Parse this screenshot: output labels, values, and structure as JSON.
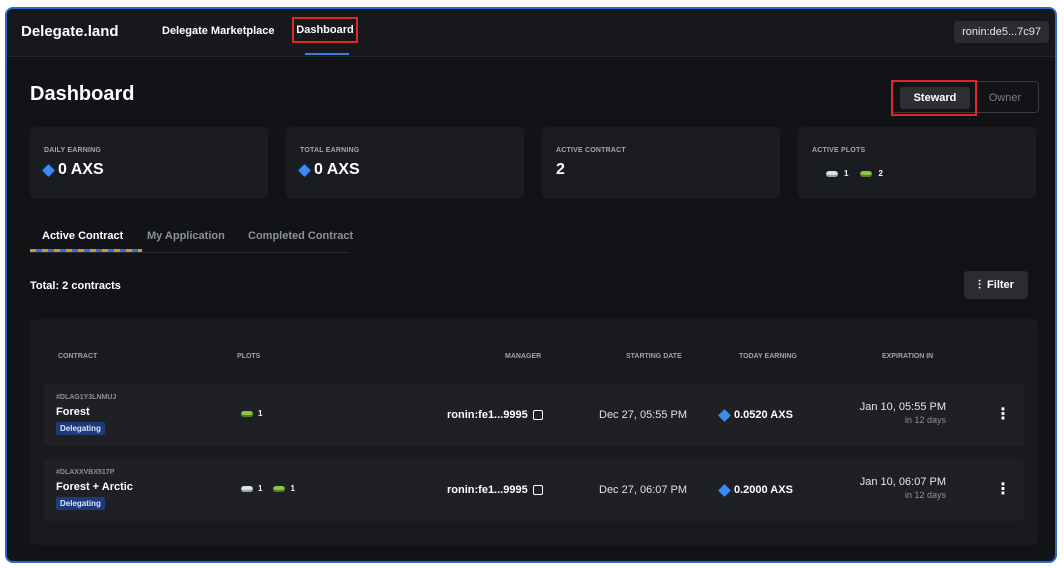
{
  "header": {
    "logo": "Delegate.land",
    "nav": {
      "marketplace": "Delegate Marketplace",
      "dashboard": "Dashboard"
    },
    "wallet": "ronin:de5...7c97"
  },
  "page": {
    "title": "Dashboard",
    "roles": {
      "steward": "Steward",
      "owner": "Owner"
    }
  },
  "stats": {
    "daily": {
      "label": "DAILY EARNING",
      "value": "0 AXS"
    },
    "total": {
      "label": "TOTAL EARNING",
      "value": "0 AXS"
    },
    "active": {
      "label": "ACTIVE CONTRACT",
      "value": "2"
    },
    "plots": {
      "label": "ACTIVE PLOTS",
      "arctic": "1",
      "forest": "2"
    }
  },
  "tabs": {
    "active": "Active Contract",
    "application": "My Application",
    "completed": "Completed Contract"
  },
  "total_text": "Total: 2 contracts",
  "filter_label": "Filter",
  "table": {
    "headers": {
      "contract": "CONTRACT",
      "plots": "PLOTS",
      "manager": "MANAGER",
      "start": "STARTING DATE",
      "earning": "TODAY EARNING",
      "expiration": "EXPIRATION IN"
    },
    "rows": [
      {
        "id": "#DLAG1Y3LNMUJ",
        "name": "Forest",
        "status": "Delegating",
        "plots_forest": "1",
        "manager": "ronin:fe1...9995",
        "start": "Dec 27, 05:55 PM",
        "earning": "0.0520 AXS",
        "exp_date": "Jan 10, 05:55 PM",
        "exp_days": "in 12 days"
      },
      {
        "id": "#DLAXXVBX517P",
        "name": "Forest + Arctic",
        "status": "Delegating",
        "plots_arctic": "1",
        "plots_forest": "1",
        "manager": "ronin:fe1...9995",
        "start": "Dec 27, 06:07 PM",
        "earning": "0.2000 AXS",
        "exp_date": "Jan 10, 06:07 PM",
        "exp_days": "in 12 days"
      }
    ]
  },
  "icons": {
    "axs": "axs-diamond-icon",
    "arctic_plot": "arctic-plot-icon",
    "forest_plot": "forest-plot-icon",
    "copy": "copy-icon",
    "filter": "filter-sliders-icon",
    "more": "more-vertical-icon"
  },
  "colors": {
    "background": "#121316",
    "accent_blue": "#3d8bf2",
    "highlight_red": "#d92b2b",
    "badge_blue": "#1e3a7a"
  }
}
